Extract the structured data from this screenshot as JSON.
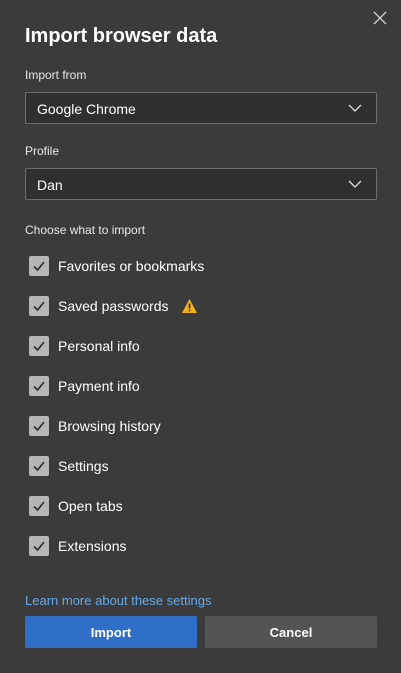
{
  "dialog": {
    "title": "Import browser data",
    "close_icon": "close-icon"
  },
  "import_from": {
    "label": "Import from",
    "value": "Google Chrome"
  },
  "profile": {
    "label": "Profile",
    "value": "Dan"
  },
  "choose": {
    "label": "Choose what to import",
    "items": [
      {
        "label": "Favorites or bookmarks",
        "checked": true
      },
      {
        "label": "Saved passwords",
        "checked": true,
        "warning": true
      },
      {
        "label": "Personal info",
        "checked": true
      },
      {
        "label": "Payment info",
        "checked": true
      },
      {
        "label": "Browsing history",
        "checked": true
      },
      {
        "label": "Settings",
        "checked": true
      },
      {
        "label": "Open tabs",
        "checked": true
      },
      {
        "label": "Extensions",
        "checked": true
      }
    ]
  },
  "footer": {
    "learn_more": "Learn more about these settings",
    "import_label": "Import",
    "cancel_label": "Cancel"
  },
  "colors": {
    "background": "#3b3b3b",
    "accent": "#2f6fc8",
    "link": "#68a9e8",
    "warning": "#f2b21c"
  }
}
